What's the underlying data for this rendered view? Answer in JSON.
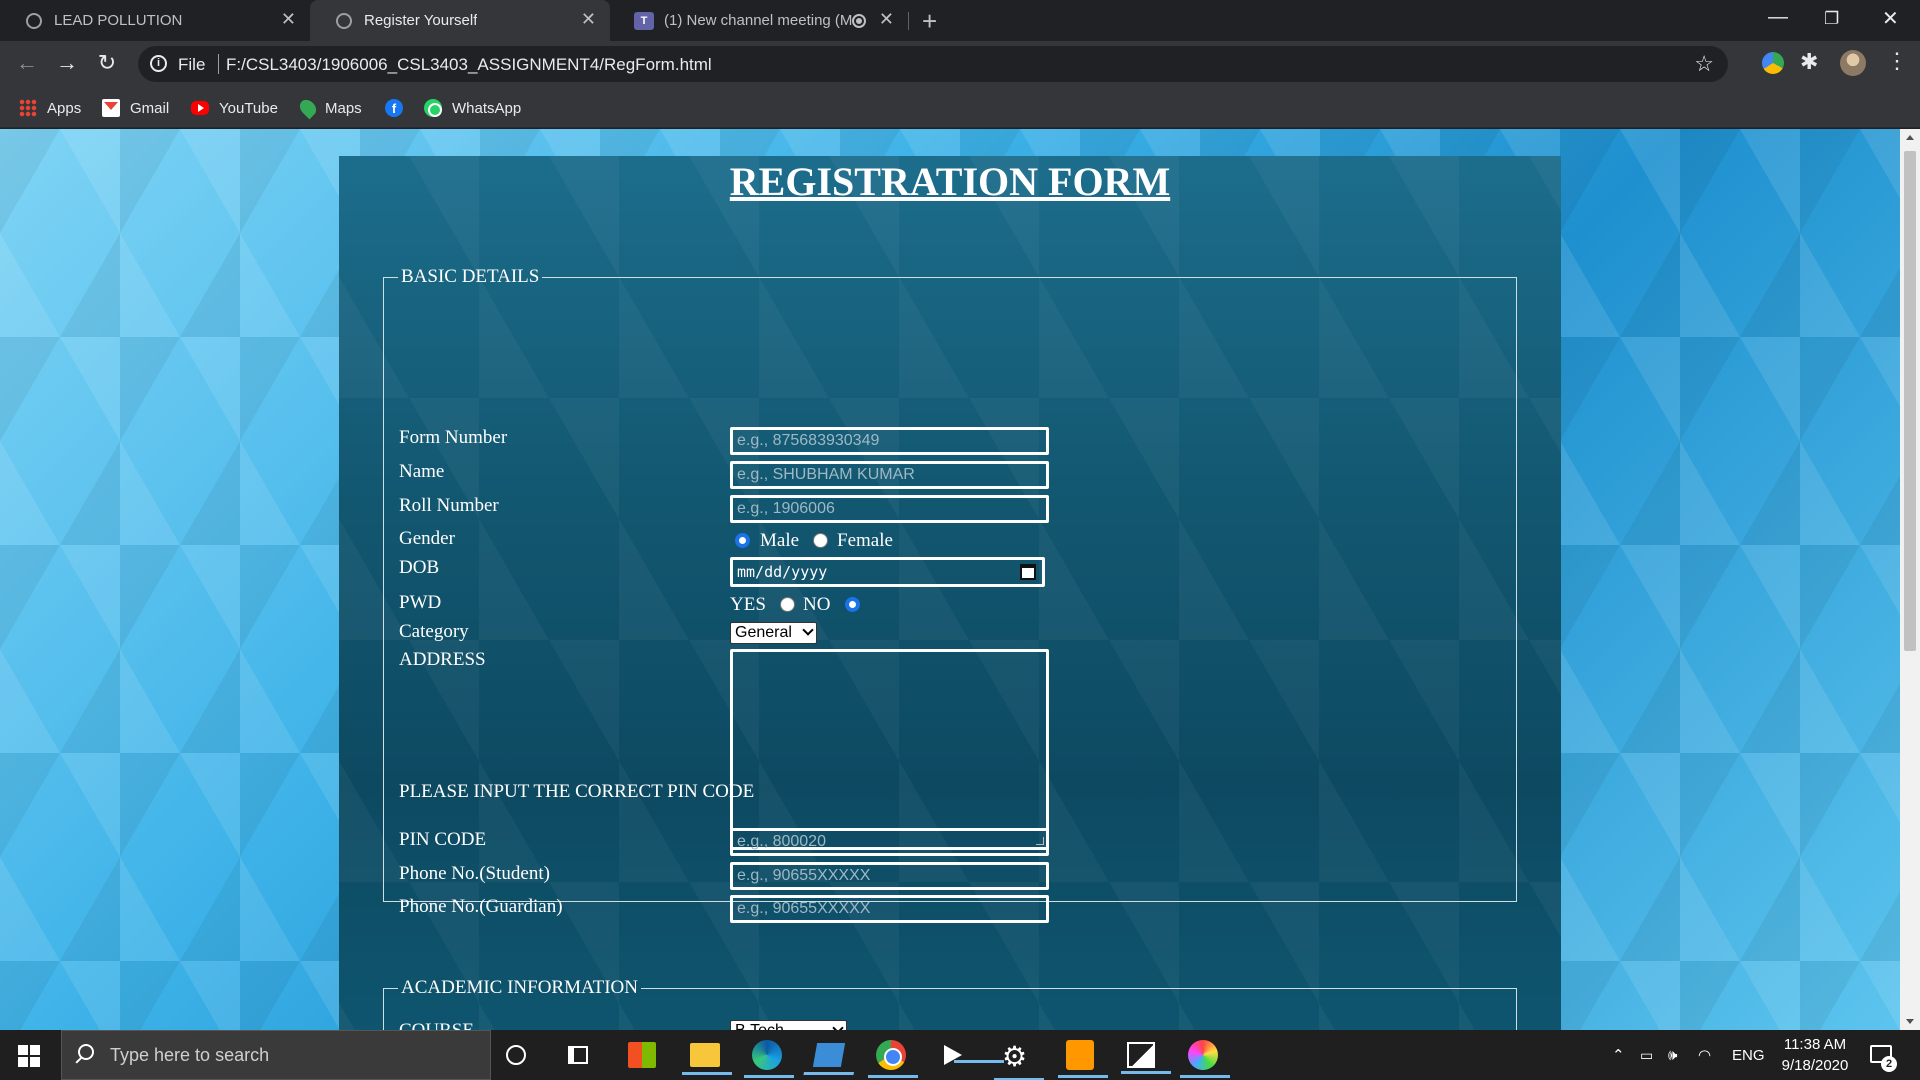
{
  "browser": {
    "tabs": [
      {
        "title": "LEAD POLLUTION",
        "active": false
      },
      {
        "title": "Register Yourself",
        "active": true
      },
      {
        "title": "(1) New channel meeting (M",
        "active": false
      }
    ],
    "window_controls": {
      "minimize": "—",
      "restore": "❐",
      "close": "✕"
    },
    "new_tab": "+",
    "url_scheme": "File",
    "url": "F:/CSL3403/1906006_CSL3403_ASSIGNMENT4/RegForm.html",
    "bookmarks": [
      "Apps",
      "Gmail",
      "YouTube",
      "Maps",
      "",
      "WhatsApp"
    ],
    "icons": {
      "back": "back-arrow-icon",
      "forward": "forward-arrow-icon",
      "reload": "reload-icon",
      "star": "bookmark-star-icon"
    }
  },
  "form": {
    "title": "REGISTRATION FORM",
    "basic": {
      "legend": "BASIC DETAILS",
      "form_number": {
        "label": "Form Number",
        "placeholder": "e.g., 875683930349"
      },
      "name": {
        "label": "Name",
        "placeholder": "e.g., SHUBHAM KUMAR"
      },
      "roll": {
        "label": "Roll Number",
        "placeholder": "e.g., 1906006"
      },
      "gender": {
        "label": "Gender",
        "options": [
          "Male",
          "Female"
        ],
        "selected": "Male"
      },
      "dob": {
        "label": "DOB",
        "placeholder": "mm/dd/yyyy"
      },
      "pwd": {
        "label": "PWD",
        "yes": "YES",
        "no": "NO",
        "selected": "NO"
      },
      "category": {
        "label": "Category",
        "selected": "General"
      },
      "address": {
        "label": "ADDRESS",
        "value": ""
      },
      "pin_notice": "PLEASE INPUT THE CORRECT PIN CODE",
      "pin": {
        "label": "PIN CODE",
        "placeholder": "e.g., 800020"
      },
      "phone_student": {
        "label": "Phone No.(Student)",
        "placeholder": "e.g., 90655XXXXX"
      },
      "phone_guardian": {
        "label": "Phone No.(Guardian)",
        "placeholder": "e.g., 90655XXXXX"
      }
    },
    "academic": {
      "legend": "ACADEMIC INFORMATION",
      "course": {
        "label": "COURSE",
        "selected": "B.Tech"
      }
    }
  },
  "taskbar": {
    "search_placeholder": "Type here to search",
    "tray": {
      "language": "ENG",
      "time": "11:38 AM",
      "date": "9/18/2020",
      "notifications": "2"
    }
  },
  "colors": {
    "panel": "#12566f",
    "accent_radio": "#1a73e8",
    "page_bg": "#3db2e8"
  }
}
